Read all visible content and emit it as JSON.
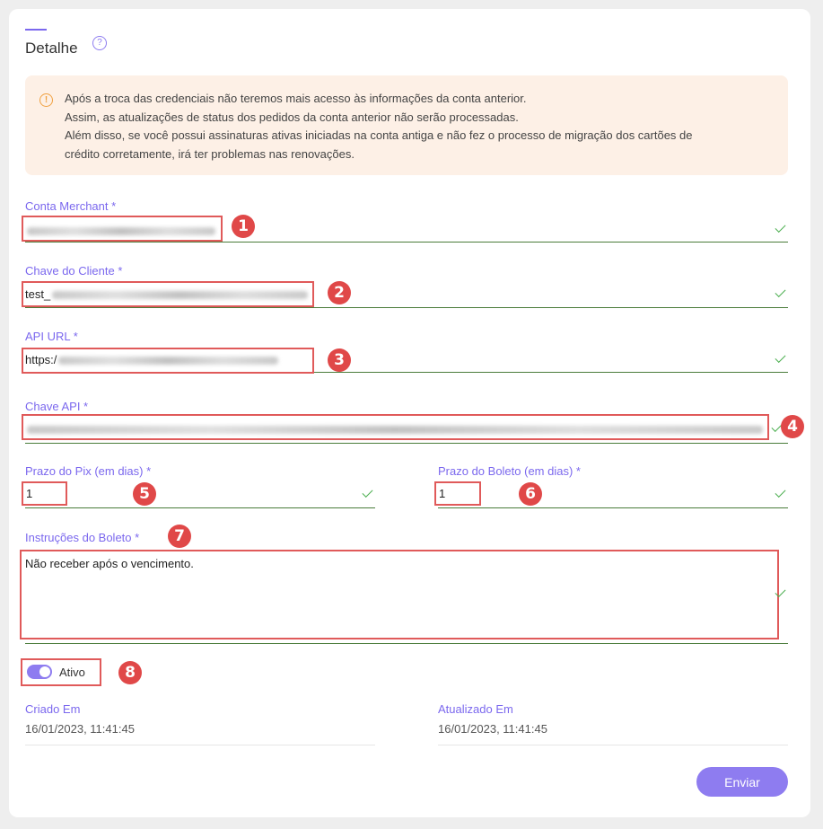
{
  "header": {
    "title": "Detalhe",
    "help_icon": "help-circle-icon"
  },
  "warning": {
    "icon": "warning-circle-icon",
    "lines": [
      "Após a troca das credenciais não teremos mais acesso às informações da conta anterior.",
      "Assim, as atualizações de status dos pedidos da conta anterior não serão processadas.",
      "Além disso, se você possui assinaturas ativas iniciadas na conta antiga e não fez o processo de migração dos cartões de",
      "crédito corretamente, irá ter problemas nas renovações."
    ]
  },
  "fields": {
    "conta_merchant": {
      "label": "Conta Merchant *",
      "value": ""
    },
    "chave_cliente": {
      "label": "Chave do Cliente *",
      "value": "test_"
    },
    "api_url": {
      "label": "API URL *",
      "value": "https:/"
    },
    "chave_api": {
      "label": "Chave API *",
      "value": ""
    },
    "prazo_pix": {
      "label": "Prazo do Pix (em dias) *",
      "value": "1"
    },
    "prazo_boleto": {
      "label": "Prazo do Boleto (em dias) *",
      "value": "1"
    },
    "instrucoes": {
      "label": "Instruções do Boleto *",
      "value": "Não receber após o vencimento."
    }
  },
  "toggle": {
    "label": "Ativo",
    "on": true
  },
  "meta": {
    "criado_label": "Criado Em",
    "criado_value": "16/01/2023, 11:41:45",
    "atualizado_label": "Atualizado Em",
    "atualizado_value": "16/01/2023, 11:41:45"
  },
  "submit_label": "Enviar",
  "annotations": [
    "1",
    "2",
    "3",
    "4",
    "5",
    "6",
    "7",
    "8"
  ],
  "colors": {
    "accent": "#8e7cf0",
    "annotation": "#e04848",
    "valid": "#4caf50"
  }
}
